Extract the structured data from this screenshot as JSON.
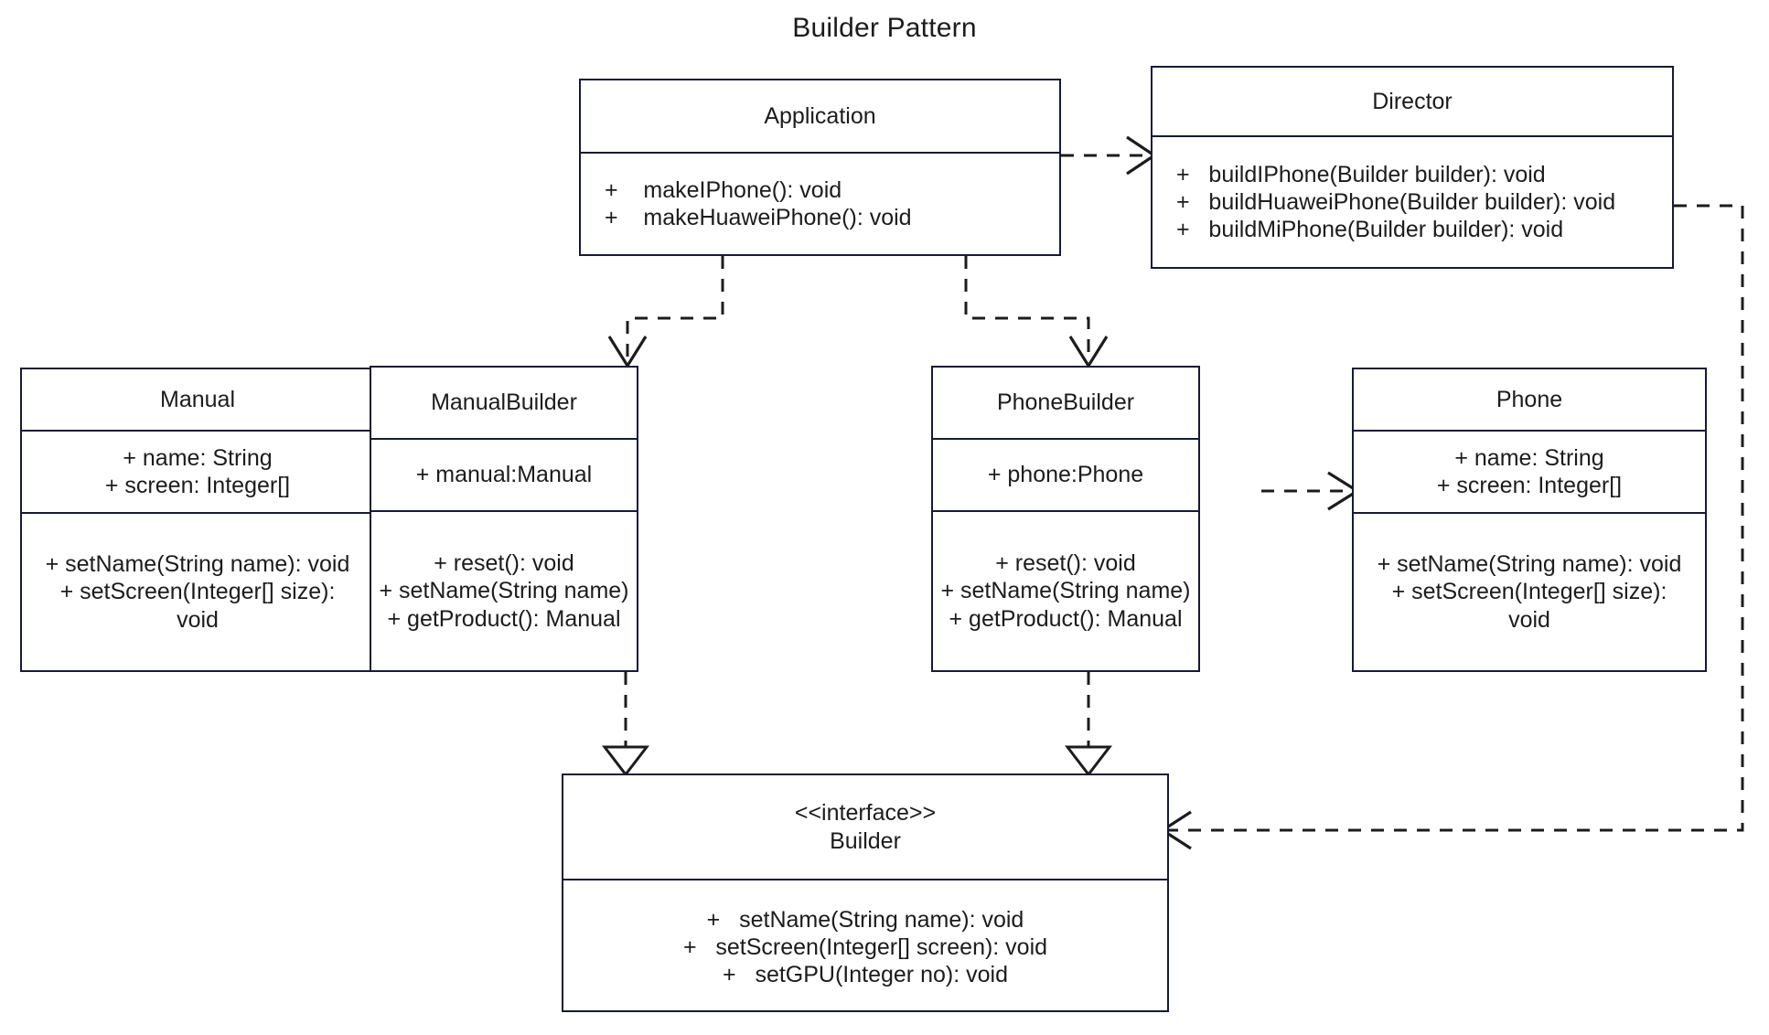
{
  "title": "Builder Pattern",
  "colors": {
    "stroke": "#161a38",
    "arrow": "#1c1c1c",
    "text": "#1c1c1c",
    "background": "#ffffff"
  },
  "classes": {
    "application": {
      "name": "Application",
      "members": [
        "+    makeIPhone(): void",
        "+    makeHuaweiPhone(): void"
      ]
    },
    "director": {
      "name": "Director",
      "members": [
        "+   buildIPhone(Builder builder): void",
        "+   buildHuaweiPhone(Builder builder): void",
        "+   buildMiPhone(Builder builder): void"
      ]
    },
    "manual": {
      "name": "Manual",
      "attributes": [
        "+ name: String",
        "+ screen: Integer[]"
      ],
      "methods": [
        "+ setName(String name): void",
        "+ setScreen(Integer[] size):",
        "void"
      ]
    },
    "manual_builder": {
      "name": "ManualBuilder",
      "attributes": [
        "+ manual:Manual"
      ],
      "methods": [
        "+ reset(): void",
        "+ setName(String name)",
        "+ getProduct(): Manual"
      ]
    },
    "phone_builder": {
      "name": "PhoneBuilder",
      "attributes": [
        "+ phone:Phone"
      ],
      "methods": [
        "+ reset(): void",
        "+ setName(String name)",
        "+ getProduct(): Manual"
      ]
    },
    "phone": {
      "name": "Phone",
      "attributes": [
        "+ name: String",
        "+ screen: Integer[]"
      ],
      "methods": [
        "+ setName(String name): void",
        "+ setScreen(Integer[] size):",
        "void"
      ]
    },
    "builder": {
      "stereotype": "<<interface>>",
      "name": "Builder",
      "methods": [
        "+   setName(String name): void",
        "+   setScreen(Integer[] screen): void",
        "+   setGPU(Integer no): void"
      ]
    }
  },
  "relationships": [
    {
      "id": "application-to-director",
      "from": "Application",
      "to": "Director",
      "kind": "dependency",
      "arrowhead": "open",
      "line": "dashed"
    },
    {
      "id": "application-to-manualbuilder",
      "from": "Application",
      "to": "ManualBuilder",
      "kind": "dependency",
      "arrowhead": "open",
      "line": "dashed"
    },
    {
      "id": "application-to-phonebuilder",
      "from": "Application",
      "to": "PhoneBuilder",
      "kind": "dependency",
      "arrowhead": "open",
      "line": "dashed"
    },
    {
      "id": "manualbuilder-to-manual",
      "from": "ManualBuilder",
      "to": "Manual",
      "kind": "dependency",
      "arrowhead": "open",
      "line": "dashed"
    },
    {
      "id": "phonebuilder-to-phone",
      "from": "PhoneBuilder",
      "to": "Phone",
      "kind": "dependency",
      "arrowhead": "open",
      "line": "dashed"
    },
    {
      "id": "manualbuilder-realizes-builder",
      "from": "ManualBuilder",
      "to": "Builder",
      "kind": "realization",
      "arrowhead": "hollow-triangle",
      "line": "dashed"
    },
    {
      "id": "phonebuilder-realizes-builder",
      "from": "PhoneBuilder",
      "to": "Builder",
      "kind": "realization",
      "arrowhead": "hollow-triangle",
      "line": "dashed"
    },
    {
      "id": "director-to-builder",
      "from": "Director",
      "to": "Builder",
      "kind": "dependency",
      "arrowhead": "open",
      "line": "dashed"
    }
  ]
}
